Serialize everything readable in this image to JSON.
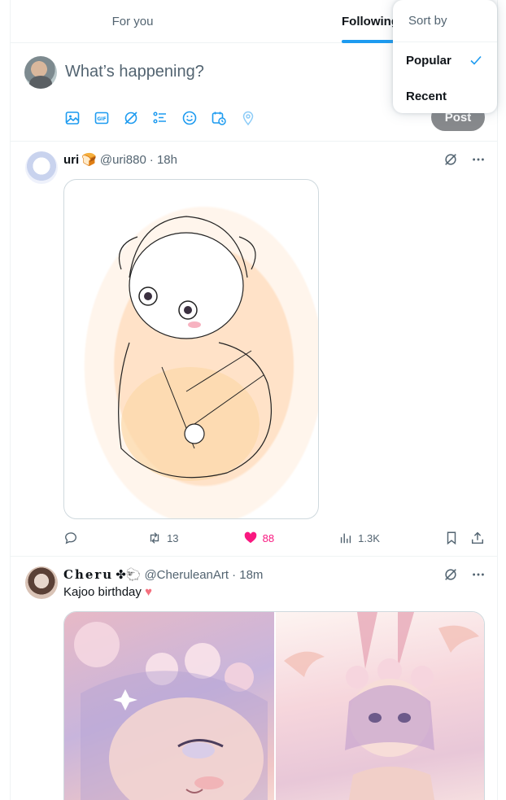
{
  "tabs": [
    {
      "label": "For you"
    },
    {
      "label": "Following"
    }
  ],
  "composer": {
    "placeholder": "What’s happening?",
    "post_label": "Post",
    "tools": [
      "image-icon",
      "gif-icon",
      "grok-icon",
      "poll-icon",
      "emoji-icon",
      "schedule-icon",
      "location-icon"
    ]
  },
  "sort_menu": {
    "title": "Sort by",
    "items": [
      {
        "label": "Popular",
        "selected": true
      },
      {
        "label": "Recent",
        "selected": false
      }
    ]
  },
  "tweets": [
    {
      "name": "uri",
      "name_emoji": "🍞",
      "handle": "@uri880",
      "time": "· 18h",
      "text": "",
      "replies": "",
      "retweets": "13",
      "likes": "88",
      "views": "1.3K",
      "liked": true
    },
    {
      "name": "Cheru",
      "name_emoji": "✤🐑",
      "handle": "@CheruleanArt",
      "time": "· 18m",
      "text": "Kajoo birthday",
      "text_emoji": "♥"
    }
  ],
  "colors": {
    "accent": "#1d9bf0",
    "like": "#f91880",
    "post_button": "#87898c"
  }
}
